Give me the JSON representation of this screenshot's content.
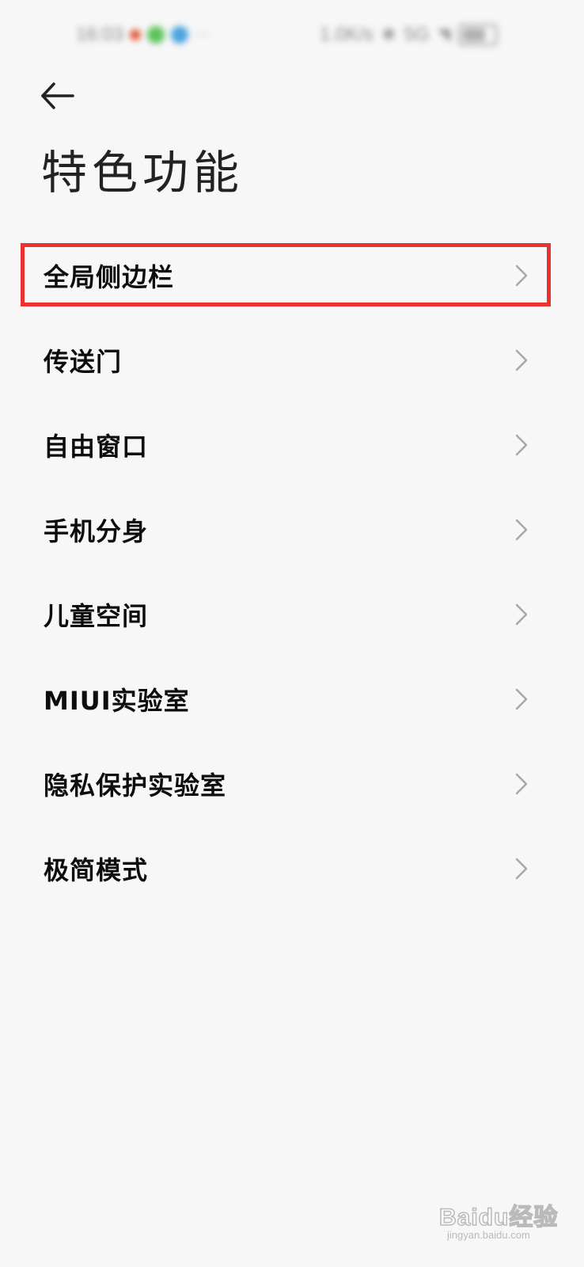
{
  "status_bar": {
    "time": "16:03",
    "right_text": "1.0K/s",
    "network": "5G",
    "icons": [
      "notification-dot-icon",
      "wechat-icon",
      "app-icon",
      "more-icon",
      "bluetooth-icon",
      "signal-icon",
      "wifi-icon",
      "battery-icon"
    ],
    "colors": {
      "dot1": "#e05a3a",
      "dot2": "#5bc45b",
      "dot3": "#4aa3e0"
    }
  },
  "header": {
    "back_icon": "arrow-left-icon",
    "title": "特色功能"
  },
  "menu": {
    "items": [
      {
        "label": "全局侧边栏",
        "highlighted": true
      },
      {
        "label": "传送门"
      },
      {
        "label": "自由窗口"
      },
      {
        "label": "手机分身"
      },
      {
        "label": "儿童空间"
      },
      {
        "label": "MIUI实验室"
      },
      {
        "label": "隐私保护实验室"
      },
      {
        "label": "极简模式"
      }
    ],
    "chevron_icon": "chevron-right-icon"
  },
  "annotation": {
    "highlight_color": "#ec3131"
  },
  "watermark": {
    "text": "Baidu经验",
    "url": "jingyan.baidu.com"
  }
}
